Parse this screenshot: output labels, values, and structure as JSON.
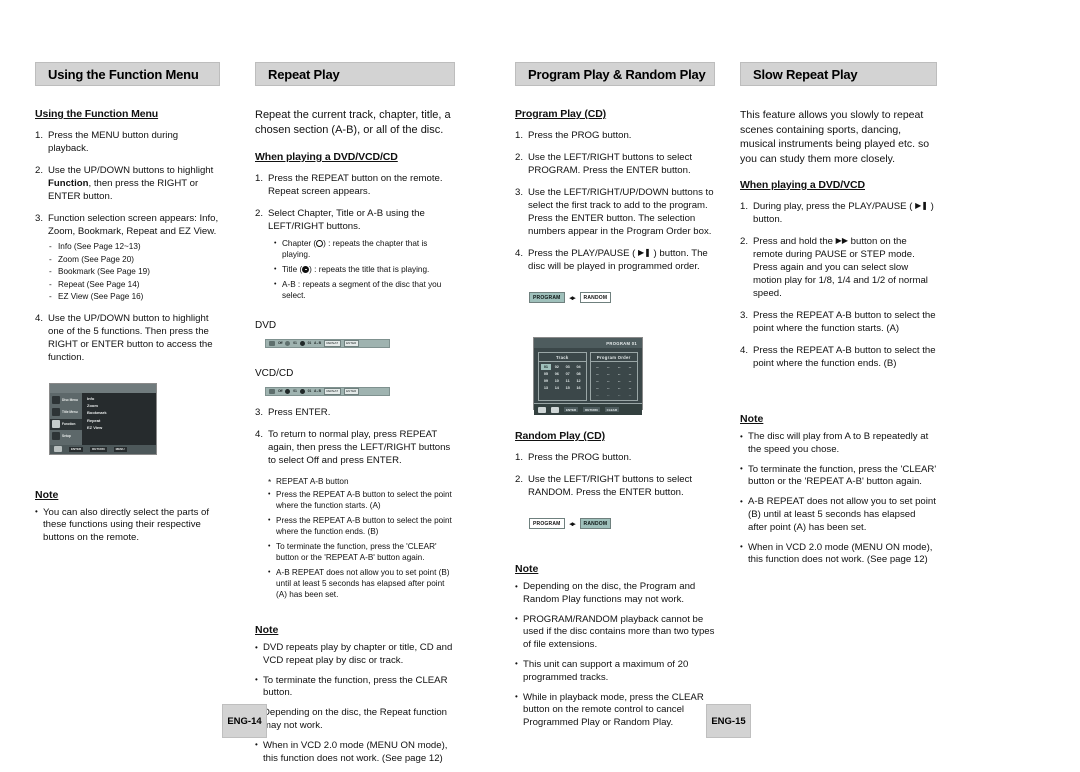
{
  "document": {
    "left_page_number": "ENG-14",
    "right_page_number": "ENG-15"
  },
  "columns": [
    {
      "header": "Using the Function Menu",
      "sub_head": "Using the Function Menu",
      "steps": [
        {
          "num": "1.",
          "text": "Press the MENU button during playback."
        },
        {
          "num": "2.",
          "text_pre": "Use the UP/DOWN buttons to highlight ",
          "bold": "Function",
          "text_post": ", then press the RIGHT or ENTER button."
        },
        {
          "num": "3.",
          "text": "Function selection screen appears: Info, Zoom, Bookmark, Repeat and EZ View."
        },
        {
          "num": "4.",
          "text": "Use the UP/DOWN button to highlight one of the 5 functions. Then press the RIGHT or ENTER button to access the function."
        }
      ],
      "see_pages": [
        "Info (See Page 12~13)",
        "Zoom (See Page 20)",
        "Bookmark (See Page 19)",
        "Repeat (See Page 14)",
        "EZ View (See Page 16)"
      ],
      "osd": {
        "left_items": [
          "Disc Menu",
          "Title Menu",
          "Function",
          "Setup"
        ],
        "right_items": [
          "Info",
          "Zoom",
          "Bookmark",
          "Repeat",
          "EZ View"
        ],
        "footer_items": [
          "ENTER",
          "RETURN",
          "MENU"
        ]
      },
      "note_head": "Note",
      "notes": [
        "You can also directly select the parts of these functions using their respective buttons on the remote."
      ]
    },
    {
      "header": "Repeat Play",
      "intro": "Repeat the current track, chapter, title, a chosen section (A-B), or all of the disc.",
      "sub_head": "When playing a DVD/VCD/CD",
      "steps": [
        {
          "num": "1.",
          "text": "Press the REPEAT button on the remote. Repeat screen appears."
        },
        {
          "num": "2.",
          "text": "Select Chapter, Title or A-B using the LEFT/RIGHT buttons."
        },
        {
          "num": "3.",
          "text": "Press ENTER."
        },
        {
          "num": "4.",
          "text": "To return to normal play, press REPEAT again, then press the LEFT/RIGHT buttons to select Off and press ENTER."
        }
      ],
      "option_bullets": [
        {
          "pre": "Chapter (",
          "icon": "chapter-icon",
          "post": ") : repeats the chapter that is playing."
        },
        {
          "pre": "Title (",
          "icon": "title-disc-icon",
          "post": ") : repeats the title that is playing."
        },
        {
          "pre": "A-B : repeats a segment of the disc that you select.",
          "icon": "",
          "post": ""
        }
      ],
      "bar_labels": {
        "dvd": "DVD",
        "vcdcd": "VCD/CD"
      },
      "status_bar": {
        "items": [
          "Off",
          "01",
          "01",
          "A - B"
        ],
        "buttons": [
          "REPEAT",
          "ENTER"
        ]
      },
      "ab_note_title": "REPEAT A-B button",
      "ab_notes": [
        "Press the REPEAT A-B button to select the point where the function starts. (A)",
        "Press the REPEAT A-B button to select the point where the function ends. (B)",
        "To terminate the function, press the 'CLEAR' button or the 'REPEAT A-B' button again.",
        "A-B REPEAT does not allow you to set point (B) until at least 5 seconds has elapsed after point (A) has been set."
      ],
      "note_head": "Note",
      "notes": [
        "DVD repeats play by chapter or title, CD and VCD repeat play by disc or track.",
        "To terminate the function, press the CLEAR button.",
        "Depending on the disc, the Repeat function may not work.",
        "When in VCD 2.0 mode (MENU ON mode), this function does not work. (See page 12)"
      ]
    },
    {
      "header": "Program Play & Random Play",
      "program": {
        "sub_head": "Program Play (CD)",
        "steps": [
          {
            "num": "1.",
            "text": "Press the PROG button."
          },
          {
            "num": "2.",
            "text": "Use the LEFT/RIGHT buttons to select PROGRAM. Press the ENTER button."
          },
          {
            "num": "3.",
            "text": "Use the LEFT/RIGHT/UP/DOWN buttons to select the first track to add to the program. Press the ENTER button. The selection numbers appear in the Program Order box."
          },
          {
            "num": "4.",
            "text_pre": "Press the PLAY/PAUSE ( ",
            "icon": "play-pause-icon",
            "text_post": " ) button. The disc will be played in programmed order."
          }
        ],
        "chips": {
          "left": "PROGRAM",
          "right": "RANDOM",
          "active": "PROGRAM"
        },
        "osd": {
          "title": "PROGRAM 01",
          "track_header": "Track",
          "order_header": "Program Order",
          "tracks": [
            "01",
            "02",
            "03",
            "04",
            "05",
            "06",
            "07",
            "08",
            "09",
            "10",
            "11",
            "12",
            "13",
            "14",
            "15",
            "16"
          ],
          "selected_track": "01",
          "order_cells": [
            "--",
            "--",
            "--",
            "--",
            "--",
            "--",
            "--",
            "--",
            "--",
            "--",
            "--",
            "--",
            "--",
            "--",
            "--",
            "--",
            "--",
            "--",
            "--",
            "--"
          ],
          "footer_items": [
            "ENTER",
            "RETURN",
            "CLEAR"
          ]
        }
      },
      "random": {
        "sub_head": "Random Play (CD)",
        "steps": [
          {
            "num": "1.",
            "text": "Press the PROG button."
          },
          {
            "num": "2.",
            "text": "Use the LEFT/RIGHT buttons to select RANDOM. Press the ENTER button."
          }
        ],
        "chips": {
          "left": "PROGRAM",
          "right": "RANDOM",
          "active": "RANDOM"
        }
      },
      "note_head": "Note",
      "notes": [
        "Depending on the disc, the Program and Random Play functions may not work.",
        "PROGRAM/RANDOM playback cannot be used if the disc contains more than two types of file extensions.",
        "This unit can support a maximum of 20 programmed tracks.",
        "While in playback mode, press the CLEAR button on the remote control to cancel Programmed Play or Random Play."
      ]
    },
    {
      "header": "Slow Repeat Play",
      "intro": "This feature allows you slowly to repeat scenes containing sports, dancing, musical instruments being played etc. so you can study them more closely.",
      "sub_head": "When playing a DVD/VCD",
      "steps": [
        {
          "num": "1.",
          "text_pre": "During play, press the PLAY/PAUSE ( ",
          "icon": "play-pause-icon",
          "text_post": " ) button."
        },
        {
          "num": "2.",
          "text_pre": "Press and hold the ",
          "icon": "fast-forward-icon",
          "text_post": " button on the remote during PAUSE or STEP mode. Press again and you can select slow motion play for 1/8, 1/4 and 1/2 of normal speed."
        },
        {
          "num": "3.",
          "text": "Press the REPEAT A-B button to select the point where the function starts. (A)"
        },
        {
          "num": "4.",
          "text": "Press the REPEAT A-B button to select the point where the function ends. (B)"
        }
      ],
      "note_head": "Note",
      "notes": [
        "The disc will play from A to B repeatedly at the speed you chose.",
        "To terminate the function, press the 'CLEAR' button or the 'REPEAT A-B' button again.",
        "A-B REPEAT does not allow you to set point (B) until at least 5 seconds has elapsed after point (A) has been set.",
        "When in VCD 2.0 mode (MENU ON mode), this function does not work. (See page 12)"
      ]
    }
  ]
}
